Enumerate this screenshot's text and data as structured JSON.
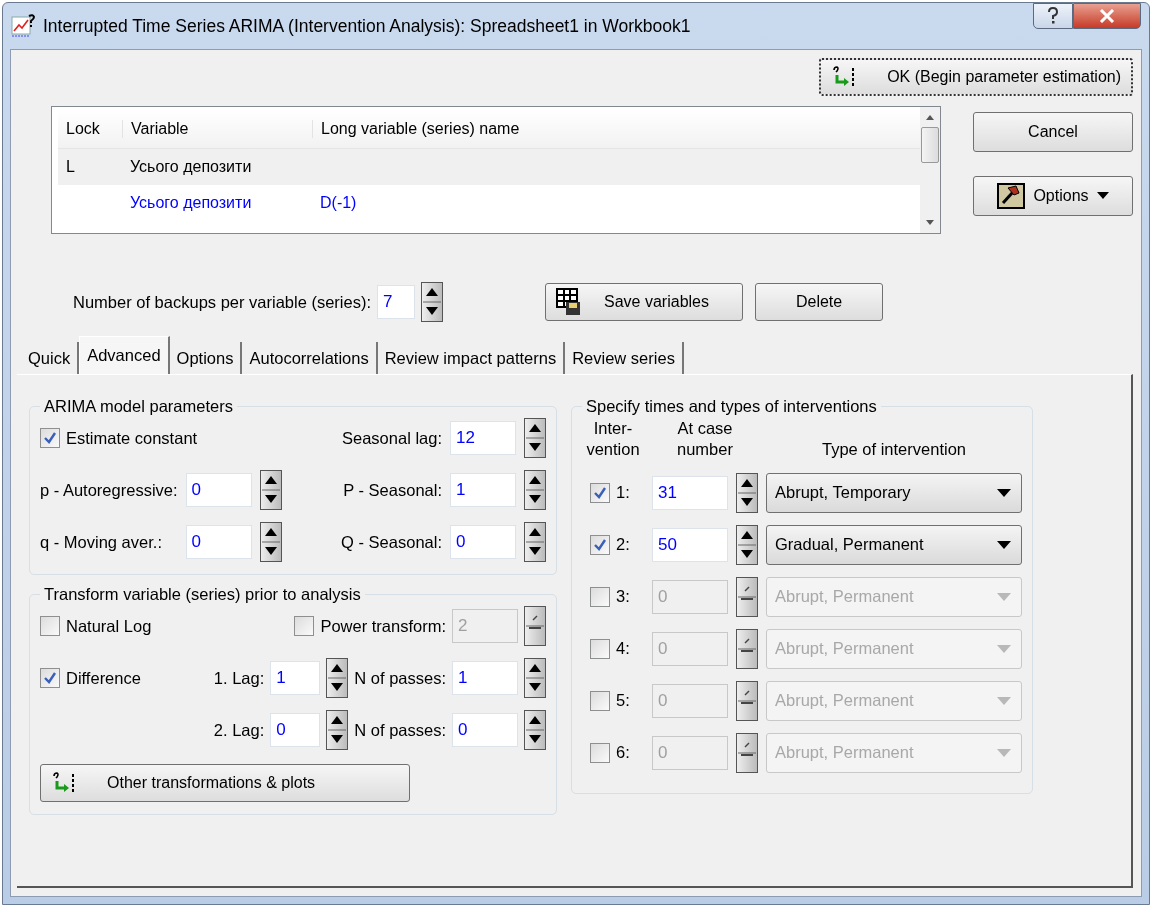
{
  "window": {
    "title": "Interrupted Time Series ARIMA (Intervention Analysis): Spreadsheet1 in Workbook1"
  },
  "ok_button": "OK (Begin parameter estimation)",
  "cancel_button": "Cancel",
  "options_button": "Options",
  "variable_list": {
    "columns": [
      "Lock",
      "Variable",
      "Long variable (series) name"
    ],
    "rows": [
      {
        "kind": "original",
        "selected": true,
        "lock": "L",
        "variable": "Усього депозити"
      },
      {
        "kind": "transformed",
        "selected": false,
        "variable": "Усього депозити",
        "long_name": "D(-1)"
      }
    ]
  },
  "backups": {
    "label": "Number of backups per variable (series):",
    "value": "7"
  },
  "save_button": "Save variables",
  "delete_button": "Delete",
  "tabs": [
    {
      "label": "Quick",
      "selected": false
    },
    {
      "label": "Advanced",
      "selected": true
    },
    {
      "label": "Options",
      "selected": false
    },
    {
      "label": "Autocorrelations",
      "selected": false
    },
    {
      "label": "Review impact patterns",
      "selected": false
    },
    {
      "label": "Review series",
      "selected": false
    }
  ],
  "arima": {
    "title": "ARIMA model parameters",
    "estimate_constant": {
      "label": "Estimate constant",
      "checked": true
    },
    "seasonal_lag": {
      "label": "Seasonal lag:",
      "value": "12"
    },
    "p": {
      "label": "p - Autoregressive:",
      "value": "0"
    },
    "P": {
      "label": "P - Seasonal:",
      "value": "1"
    },
    "q": {
      "label": "q - Moving aver.:",
      "value": "0"
    },
    "Q": {
      "label": "Q - Seasonal:",
      "value": "0"
    }
  },
  "transform": {
    "title": "Transform variable (series) prior to analysis",
    "natural_log": {
      "label": "Natural Log",
      "checked": false
    },
    "power_transform": {
      "label": "Power transform:",
      "checked": false,
      "value": "2"
    },
    "difference": {
      "label": "Difference",
      "checked": true
    },
    "lag1": {
      "label": "1. Lag:",
      "value": "1"
    },
    "passes1": {
      "label": "N of passes:",
      "value": "1"
    },
    "lag2": {
      "label": "2. Lag:",
      "value": "0"
    },
    "passes2": {
      "label": "N of passes:",
      "value": "0"
    },
    "other_button": "Other transformations & plots"
  },
  "interventions": {
    "title": "Specify times and types of interventions",
    "columns": [
      "Inter-\nvention",
      "At case\nnumber",
      "Type of intervention"
    ],
    "rows": [
      {
        "label": "1:",
        "checked": true,
        "case": "31",
        "type": "Abrupt, Temporary"
      },
      {
        "label": "2:",
        "checked": true,
        "case": "50",
        "type": "Gradual, Permanent"
      },
      {
        "label": "3:",
        "checked": false,
        "case": "0",
        "type": "Abrupt, Permanent"
      },
      {
        "label": "4:",
        "checked": false,
        "case": "0",
        "type": "Abrupt, Permanent"
      },
      {
        "label": "5:",
        "checked": false,
        "case": "0",
        "type": "Abrupt, Permanent"
      },
      {
        "label": "6:",
        "checked": false,
        "case": "0",
        "type": "Abrupt, Permanent"
      }
    ]
  }
}
